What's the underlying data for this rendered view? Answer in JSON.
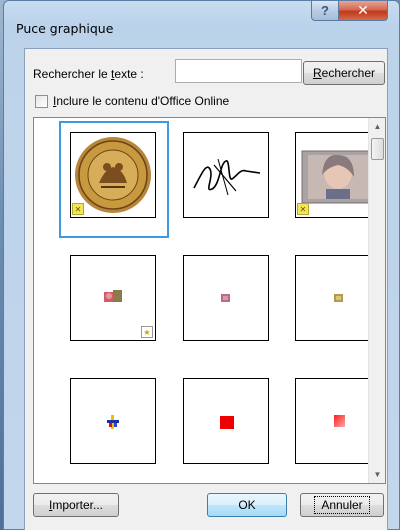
{
  "window": {
    "title": "Puce graphique",
    "help_icon": "question-icon",
    "close_icon": "close-icon"
  },
  "search": {
    "label": "Rechercher le texte :",
    "input_value": "",
    "button_label": "Rechercher"
  },
  "include_online": {
    "label": "Inclure le contenu d'Office Online",
    "checked": false
  },
  "gallery": {
    "items": [
      {
        "name": "seal",
        "selected": true,
        "badge": "star-badge"
      },
      {
        "name": "signature",
        "selected": false,
        "badge": ""
      },
      {
        "name": "portrait-photo",
        "selected": false,
        "badge": "star-badge"
      },
      {
        "name": "flower-bullet",
        "selected": false,
        "badge": "animated-star-badge"
      },
      {
        "name": "small-pink-bullet",
        "selected": false,
        "badge": ""
      },
      {
        "name": "small-gold-bullet",
        "selected": false,
        "badge": ""
      },
      {
        "name": "cross-bullet",
        "selected": false,
        "badge": ""
      },
      {
        "name": "red-square-bullet",
        "selected": false,
        "badge": ""
      },
      {
        "name": "red-gradient-bullet",
        "selected": false,
        "badge": ""
      }
    ]
  },
  "footer": {
    "import_label": "Importer...",
    "ok_label": "OK",
    "cancel_label": "Annuler"
  },
  "colors": {
    "selection_frame": "#3c9ae4",
    "close_button": "#c0391c",
    "title_bar": "#b9d1ea"
  }
}
